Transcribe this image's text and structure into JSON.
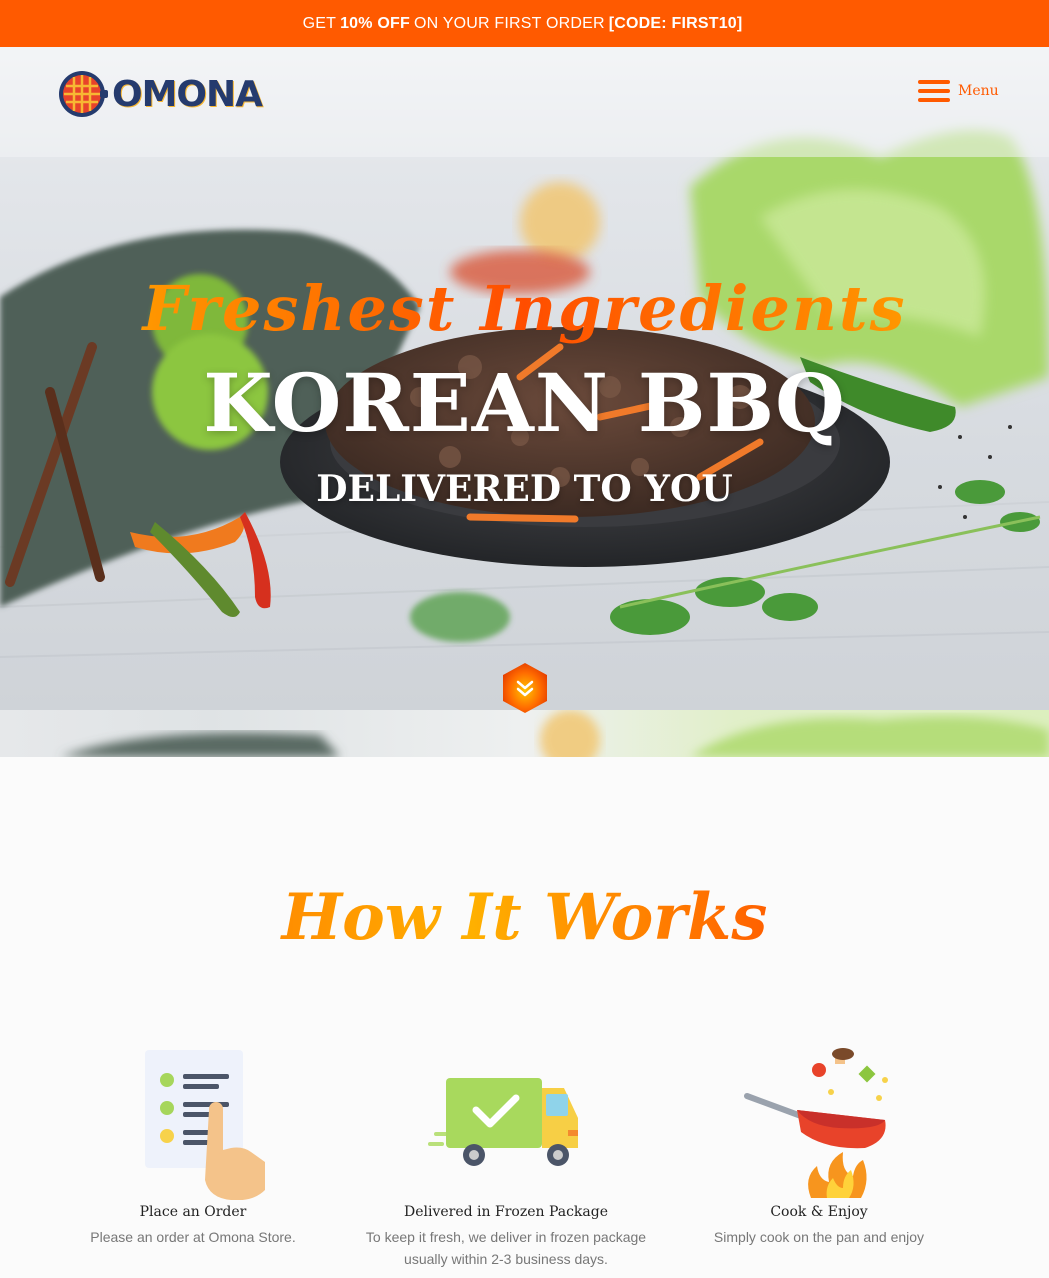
{
  "promo": {
    "prefix": "GET",
    "discount": "10% OFF",
    "middle": "ON YOUR FIRST ORDER",
    "code": "[CODE: FIRST10]"
  },
  "header": {
    "logo_text": "OMONA",
    "menu_label": "Menu"
  },
  "hero": {
    "script": "Freshest Ingredients",
    "title": "KOREAN BBQ",
    "subtitle": "DELIVERED TO YOU"
  },
  "how_it_works": {
    "title": "How It Works",
    "steps": [
      {
        "title": "Place an Order",
        "text": "Please an order at Omona Store.",
        "icon": "order-list-icon"
      },
      {
        "title": "Delivered in Frozen Package",
        "text": "To keep it fresh, we deliver in frozen package usually within 2-3 business days.",
        "icon": "delivery-truck-icon"
      },
      {
        "title": "Cook & Enjoy",
        "text": "Simply cook on the pan and enjoy",
        "icon": "frying-pan-icon"
      }
    ]
  },
  "colors": {
    "accent": "#ff5a00",
    "brand_navy": "#253b6e"
  }
}
